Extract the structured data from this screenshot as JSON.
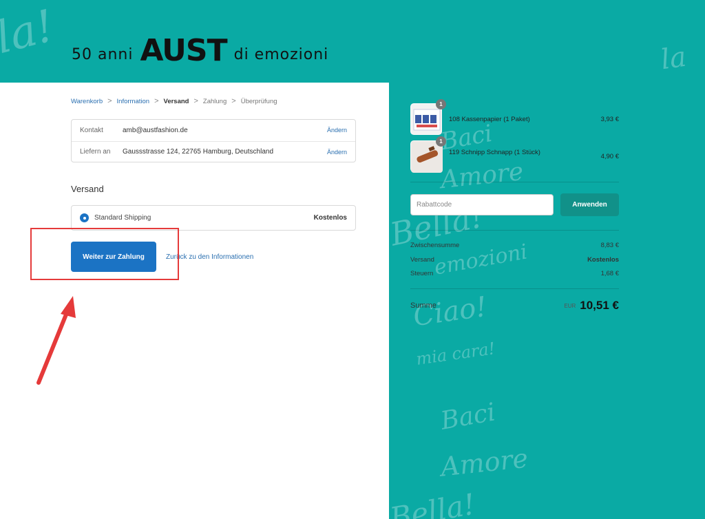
{
  "header": {
    "logo_pre": "50 anni",
    "logo_brand": "AUST",
    "logo_post": "di emozioni"
  },
  "breadcrumb": {
    "items": [
      "Warenkorb",
      "Information",
      "Versand",
      "Zahlung",
      "Überprüfung"
    ],
    "separator": ">"
  },
  "review": {
    "contact_label": "Kontakt",
    "contact_value": "amb@austfashion.de",
    "contact_change": "Ändern",
    "ship_label": "Liefern an",
    "ship_value": "Gaussstrasse 124, 22765 Hamburg, Deutschland",
    "ship_change": "Ändern"
  },
  "shipping": {
    "title": "Versand",
    "method_name": "Standard Shipping",
    "method_price": "Kostenlos"
  },
  "actions": {
    "continue_label": "Weiter zur Zahlung",
    "back_label": "Zurück zu den Informationen"
  },
  "cart": {
    "items": [
      {
        "name": "108 Kassenpapier (1 Paket)",
        "price": "3,93 €",
        "qty": "1"
      },
      {
        "name": "119 Schnipp Schnapp (1 Stück)",
        "price": "4,90 €",
        "qty": "1"
      }
    ],
    "discount_placeholder": "Rabattcode",
    "apply_label": "Anwenden",
    "subtotal_label": "Zwischensumme",
    "subtotal_value": "8,83 €",
    "shipping_label": "Versand",
    "shipping_value": "Kostenlos",
    "tax_label": "Steuern",
    "tax_value": "1,68 €",
    "total_label": "Summe",
    "total_currency": "EUR",
    "total_value": "10,51 €"
  },
  "colors": {
    "teal": "#0aaaa4",
    "primary": "#1b73c4",
    "apply": "#119189",
    "highlight": "#e53a3a"
  }
}
